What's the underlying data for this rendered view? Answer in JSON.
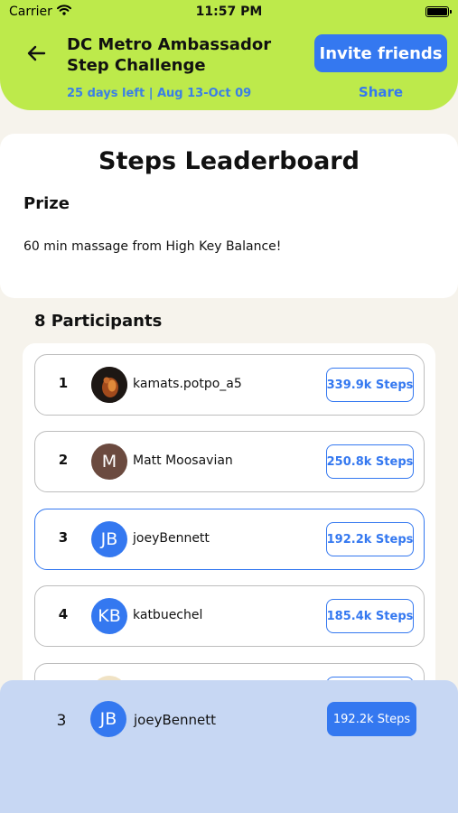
{
  "status": {
    "carrier": "Carrier",
    "time": "11:57 PM"
  },
  "header": {
    "title": "DC Metro Ambassador Step Challenge",
    "subtitle": "25 days left | Aug 13-Oct 09",
    "invite_label": "Invite friends",
    "share_label": "Share"
  },
  "board": {
    "title": "Steps Leaderboard",
    "prize_label": "Prize",
    "prize_text": "60 min massage from High Key Balance!",
    "participants_label": "8 Participants"
  },
  "participants": [
    {
      "rank": "1",
      "avatar": "",
      "name": "kamats.potpo_a5",
      "steps": "339.9k Steps",
      "avatar_color": "#3a2a22"
    },
    {
      "rank": "2",
      "avatar": "M",
      "name": "Matt Moosavian",
      "steps": "250.8k Steps",
      "avatar_color": "#6b4a3f"
    },
    {
      "rank": "3",
      "avatar": "JB",
      "name": "joeyBennett",
      "steps": "192.2k Steps",
      "avatar_color": "#3478f0"
    },
    {
      "rank": "4",
      "avatar": "KB",
      "name": "katbuechel",
      "steps": "185.4k Steps",
      "avatar_color": "#3478f0"
    }
  ],
  "current_user": {
    "rank": "3",
    "avatar": "JB",
    "name": "joeyBennett",
    "steps": "192.2k Steps"
  },
  "colors": {
    "accent": "#3478f0",
    "header_bg": "#bdea4b",
    "bottom_bg": "#c7d7f3"
  }
}
